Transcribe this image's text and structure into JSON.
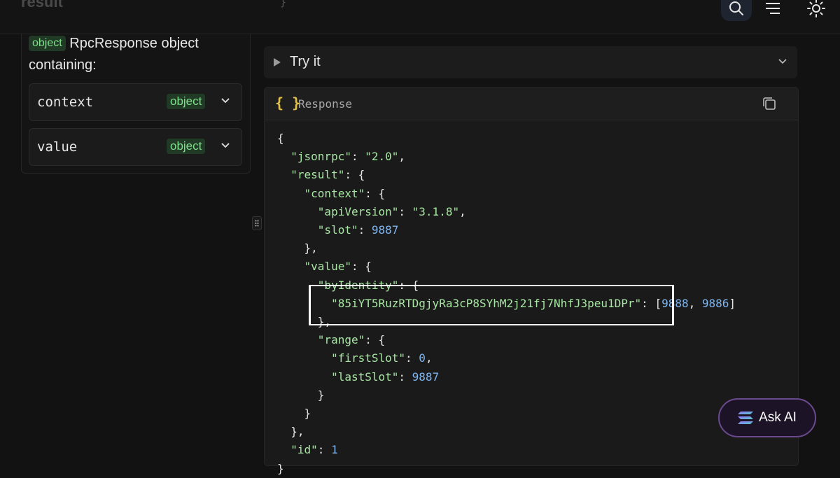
{
  "topbar": {
    "cut_title": "result",
    "cut_code": "  }",
    "icons": [
      "search-icon",
      "menu-icon",
      "sun-icon"
    ]
  },
  "left_panel": {
    "badge": "object",
    "description": "RpcResponse object containing:",
    "fields": [
      {
        "name": "context",
        "type": "object"
      },
      {
        "name": "value",
        "type": "object"
      }
    ]
  },
  "try_it": {
    "label": "Try it"
  },
  "response": {
    "braces": "{ }",
    "label": "Response",
    "jsonrpc_key": "\"jsonrpc\"",
    "jsonrpc_value": "\"2.0\"",
    "result_key": "\"result\"",
    "context_key": "\"context\"",
    "apiVersion_key": "\"apiVersion\"",
    "apiVersion_value": "\"3.1.8\"",
    "slot_key": "\"slot\"",
    "slot_value": "9887",
    "value_key": "\"value\"",
    "byIdentity_key": "\"byIdentity\"",
    "identity_key": "\"85iYT5RuzRTDgjyRa3cP8SYhM2j21fj7NhfJ3peu1DPr\"",
    "identity_values": [
      "9888",
      "9886"
    ],
    "range_key": "\"range\"",
    "firstSlot_key": "\"firstSlot\"",
    "firstSlot_value": "0",
    "lastSlot_key": "\"lastSlot\"",
    "lastSlot_value": "9887",
    "id_key": "\"id\"",
    "id_value": "1"
  },
  "ask_ai": {
    "label": "Ask AI"
  },
  "colors": {
    "background": "#121212",
    "badge_bg": "#213a26",
    "badge_text": "#7ee08a",
    "string": "#a8e6a4",
    "number": "#7fb6f0",
    "braces_icon": "#e3c04a",
    "ask_ai_border": "#6a4a8e"
  }
}
